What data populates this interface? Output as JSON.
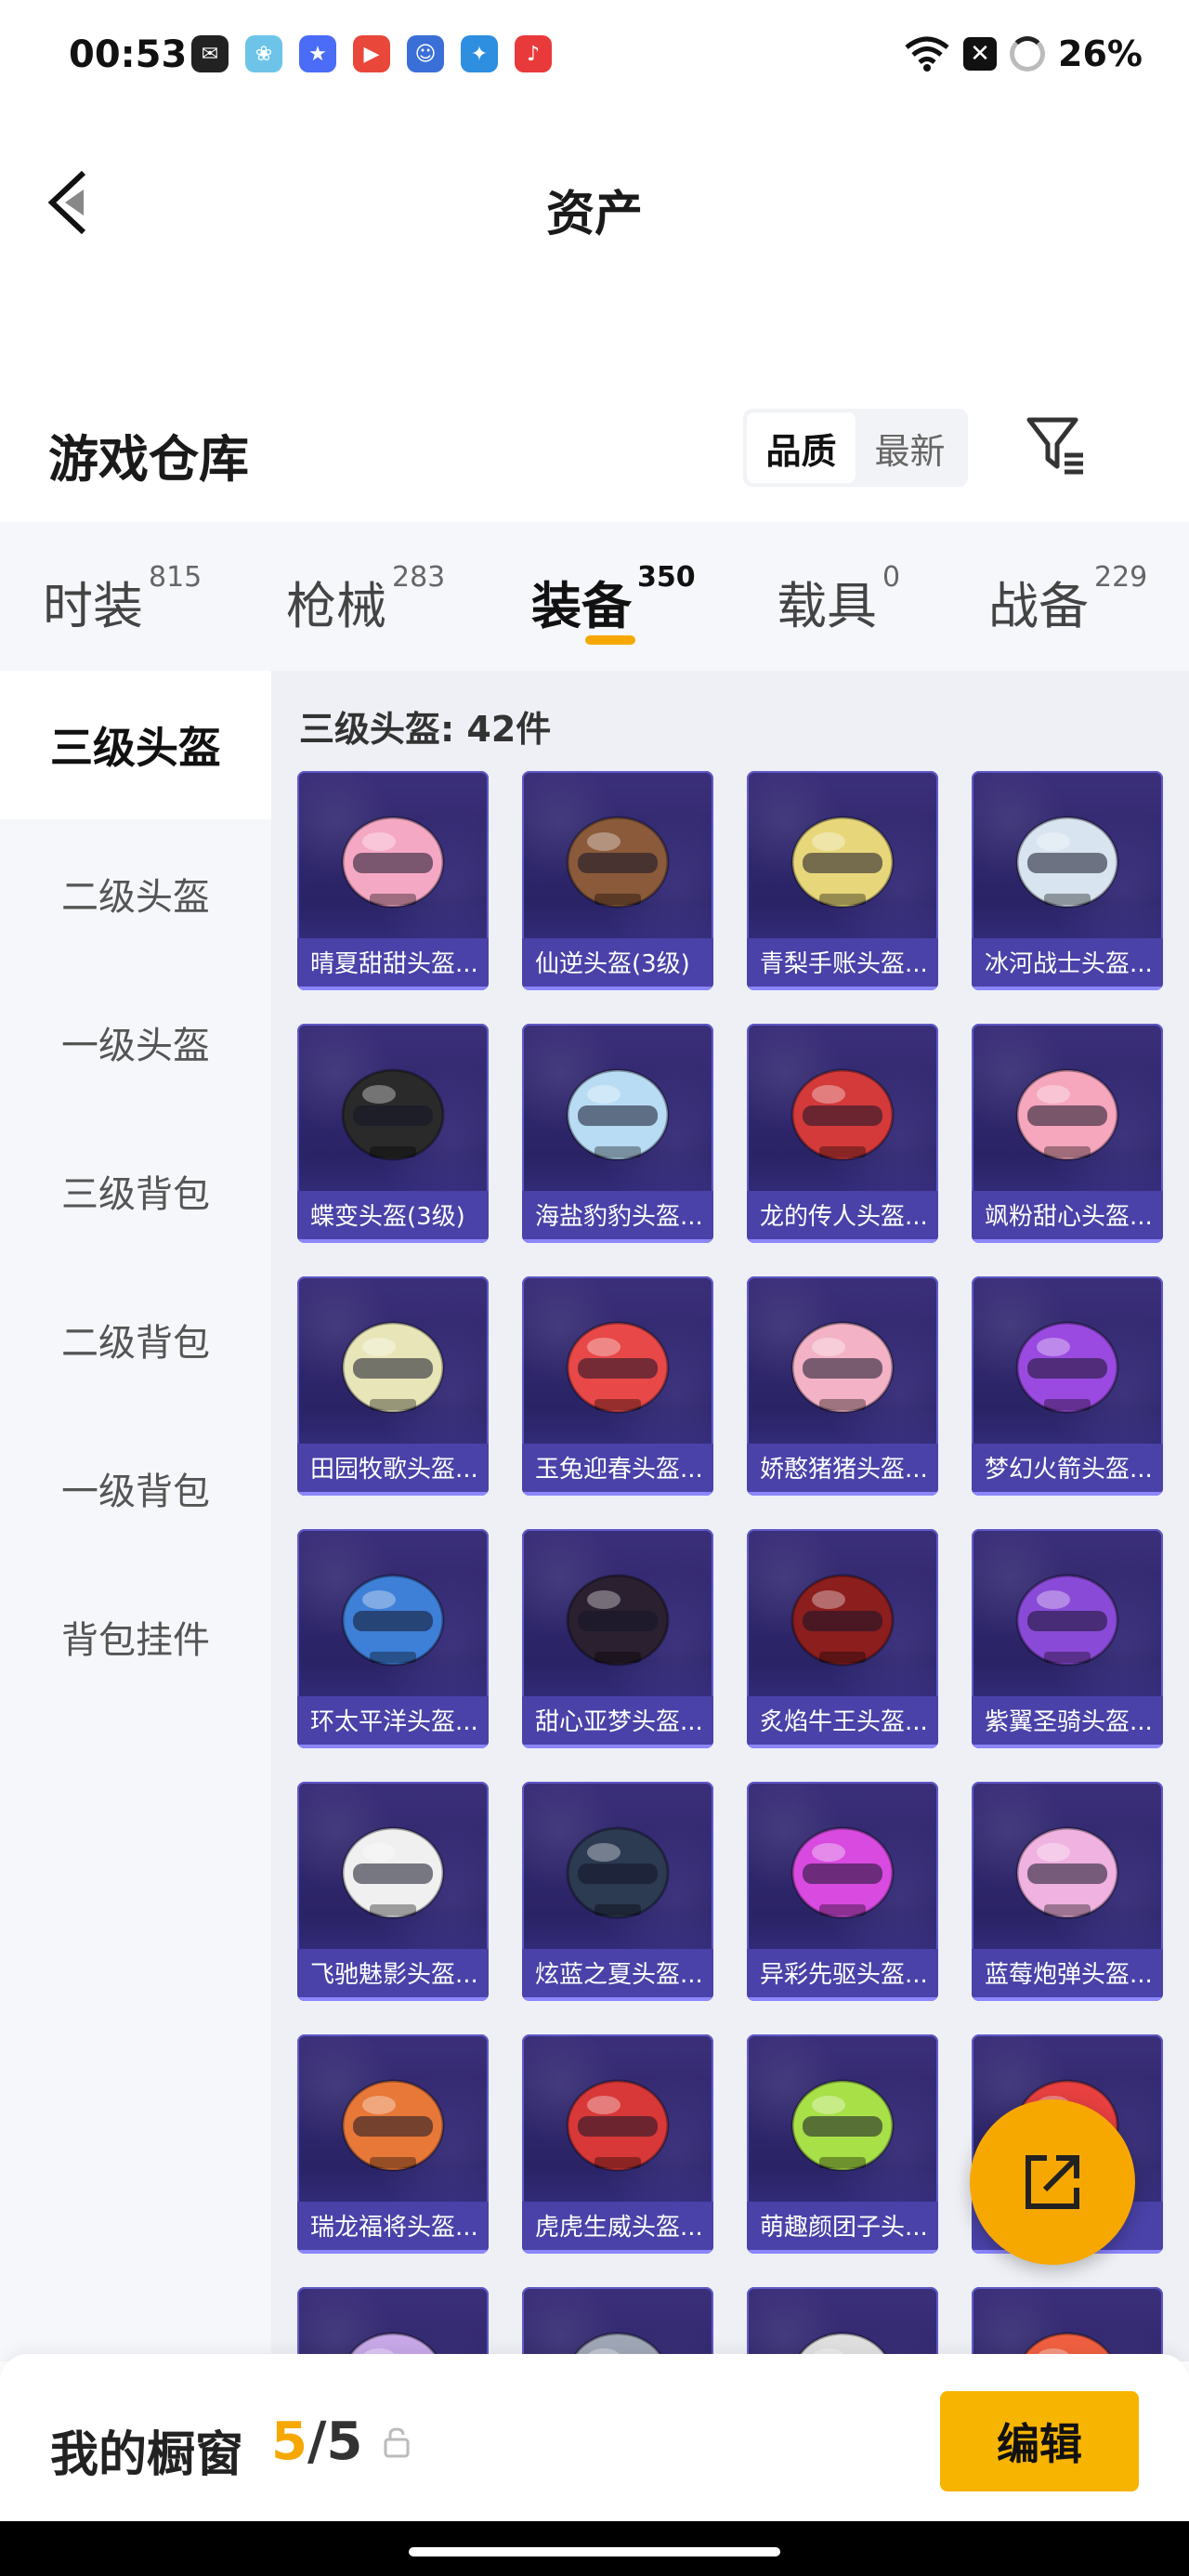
{
  "status": {
    "time": "00:53",
    "battery": "26%",
    "apps": [
      {
        "icon": "wechat-icon",
        "color": "#222222",
        "glyph": "✉"
      },
      {
        "icon": "photos-icon",
        "color": "#6ec4e8",
        "glyph": "❀"
      },
      {
        "icon": "star-app-icon",
        "color": "#4a6cf7",
        "glyph": "★"
      },
      {
        "icon": "video-app-icon",
        "color": "#e8473a",
        "glyph": "▶"
      },
      {
        "icon": "game-app-icon",
        "color": "#3a6fd8",
        "glyph": "☺"
      },
      {
        "icon": "game2-app-icon",
        "color": "#2e8ee0",
        "glyph": "✦"
      },
      {
        "icon": "music-app-icon",
        "color": "#e83a3a",
        "glyph": "♪"
      }
    ]
  },
  "header": {
    "title": "资产"
  },
  "warehouse": {
    "title": "游戏仓库",
    "sort_options": [
      "品质",
      "最新"
    ],
    "active_sort": "品质"
  },
  "categories": [
    {
      "label": "时装",
      "count": "815"
    },
    {
      "label": "枪械",
      "count": "283"
    },
    {
      "label": "装备",
      "count": "350",
      "active": true
    },
    {
      "label": "载具",
      "count": "0"
    },
    {
      "label": "战备",
      "count": "229"
    }
  ],
  "sidebar": {
    "items": [
      "三级头盔",
      "二级头盔",
      "一级头盔",
      "三级背包",
      "二级背包",
      "一级背包",
      "背包挂件"
    ],
    "active": "三级头盔"
  },
  "content": {
    "heading": "三级头盔: 42件",
    "items": [
      {
        "name": "晴夏甜甜头盔...",
        "color": "#f5a8c4"
      },
      {
        "name": "仙逆头盔(3级)",
        "color": "#8a5a3a"
      },
      {
        "name": "青梨手账头盔...",
        "color": "#e8d77a"
      },
      {
        "name": "冰河战士头盔...",
        "color": "#d8e4f0"
      },
      {
        "name": "蝶变头盔(3级)",
        "color": "#2a2a2a"
      },
      {
        "name": "海盐豹豹头盔...",
        "color": "#b9dcf5"
      },
      {
        "name": "龙的传人头盔...",
        "color": "#d43a3a"
      },
      {
        "name": "飒粉甜心头盔...",
        "color": "#f6a6bd"
      },
      {
        "name": "田园牧歌头盔...",
        "color": "#e8e6b8"
      },
      {
        "name": "玉兔迎春头盔...",
        "color": "#e84848"
      },
      {
        "name": "娇憨猪猪头盔...",
        "color": "#f3b2c6"
      },
      {
        "name": "梦幻火箭头盔...",
        "color": "#9a4ae0"
      },
      {
        "name": "环太平洋头盔...",
        "color": "#3e7fd8"
      },
      {
        "name": "甜心亚梦头盔...",
        "color": "#2b2030"
      },
      {
        "name": "炙焰牛王头盔...",
        "color": "#8c1e1e"
      },
      {
        "name": "紫翼圣骑头盔...",
        "color": "#8a4ad8"
      },
      {
        "name": "飞驰魅影头盔...",
        "color": "#f0f0f0"
      },
      {
        "name": "炫蓝之夏头盔...",
        "color": "#2c3a52"
      },
      {
        "name": "异彩先驱头盔...",
        "color": "#d84ae0"
      },
      {
        "name": "蓝莓炮弹头盔...",
        "color": "#f0b2e0"
      },
      {
        "name": "瑞龙福将头盔...",
        "color": "#e87838"
      },
      {
        "name": "虎虎生威头盔...",
        "color": "#d83838"
      },
      {
        "name": "萌趣颜团子头...",
        "color": "#a8e048"
      },
      {
        "name": "",
        "color": "#e84040"
      },
      {
        "name": "",
        "color": "#c8a8e8"
      },
      {
        "name": "",
        "color": "#a0a8b8"
      },
      {
        "name": "",
        "color": "#e0e0e0"
      },
      {
        "name": "",
        "color": "#f06040"
      }
    ]
  },
  "bottom": {
    "title": "我的橱窗",
    "count_current": "5",
    "count_sep": "/5",
    "edit_label": "编辑"
  },
  "colors": {
    "accent": "#f7b400",
    "card_bg": "#2a2365"
  }
}
